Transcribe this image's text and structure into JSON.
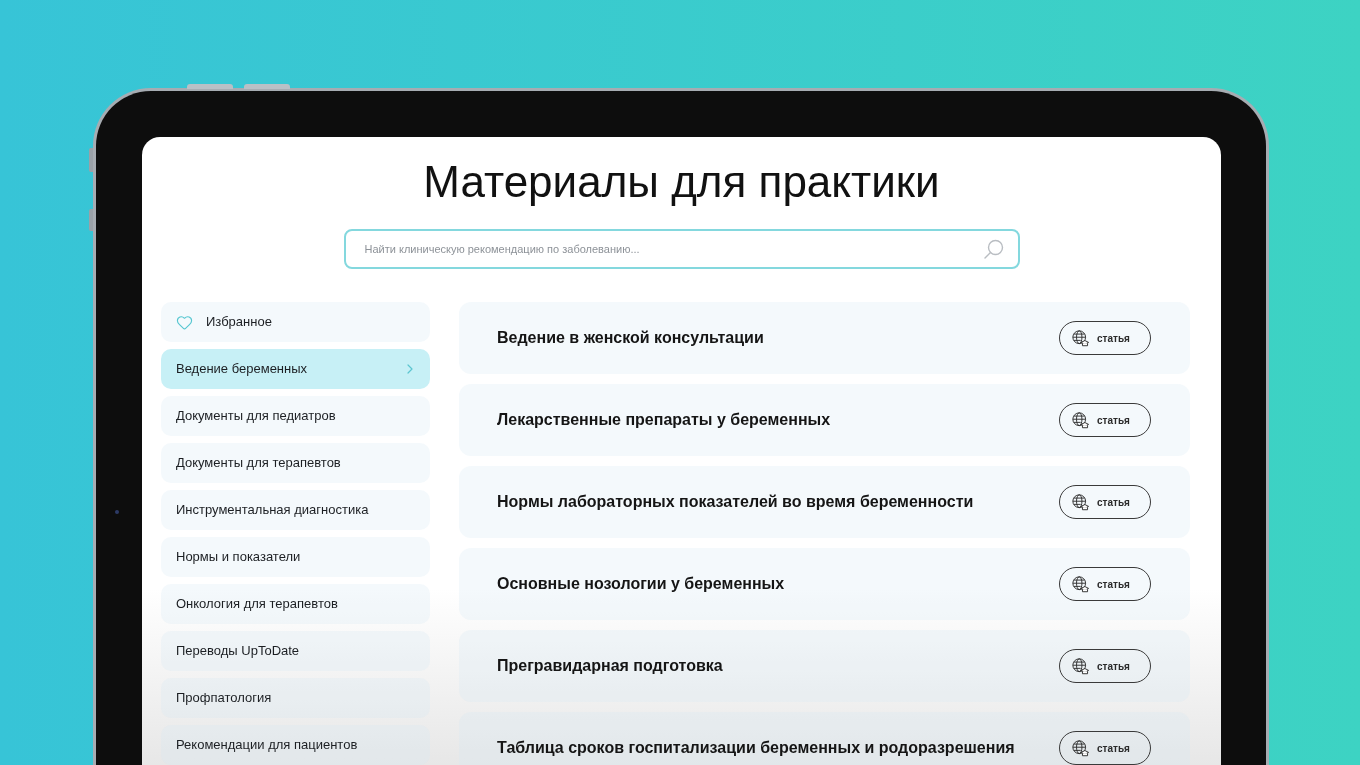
{
  "page": {
    "title": "Материалы для практики"
  },
  "search": {
    "placeholder": "Найти клиническую рекомендацию по заболеванию..."
  },
  "sidebar": {
    "items": [
      {
        "label": "Избранное",
        "kind": "favorites",
        "selected": false
      },
      {
        "label": "Ведение беременных",
        "kind": "category",
        "selected": true
      },
      {
        "label": "Документы для педиатров",
        "kind": "category",
        "selected": false
      },
      {
        "label": "Документы для терапевтов",
        "kind": "category",
        "selected": false
      },
      {
        "label": "Инструментальная диагностика",
        "kind": "category",
        "selected": false
      },
      {
        "label": "Нормы и показатели",
        "kind": "category",
        "selected": false
      },
      {
        "label": "Онкология для терапевтов",
        "kind": "category",
        "selected": false
      },
      {
        "label": "Переводы UpToDate",
        "kind": "category",
        "selected": false
      },
      {
        "label": "Профпатология",
        "kind": "category",
        "selected": false
      },
      {
        "label": "Рекомендации для пациентов",
        "kind": "category",
        "selected": false
      }
    ]
  },
  "materials": [
    {
      "title": "Ведение в женской консультации",
      "tag": "статья"
    },
    {
      "title": "Лекарственные препараты у беременных",
      "tag": "статья"
    },
    {
      "title": "Нормы лабораторных показателей во время беременности",
      "tag": "статья"
    },
    {
      "title": "Основные нозологии у беременных",
      "tag": "статья"
    },
    {
      "title": "Прегравидарная подготовка",
      "tag": "статья"
    },
    {
      "title": "Таблица сроков госпитализации беременных и родоразрешения",
      "tag": "статья"
    }
  ]
}
